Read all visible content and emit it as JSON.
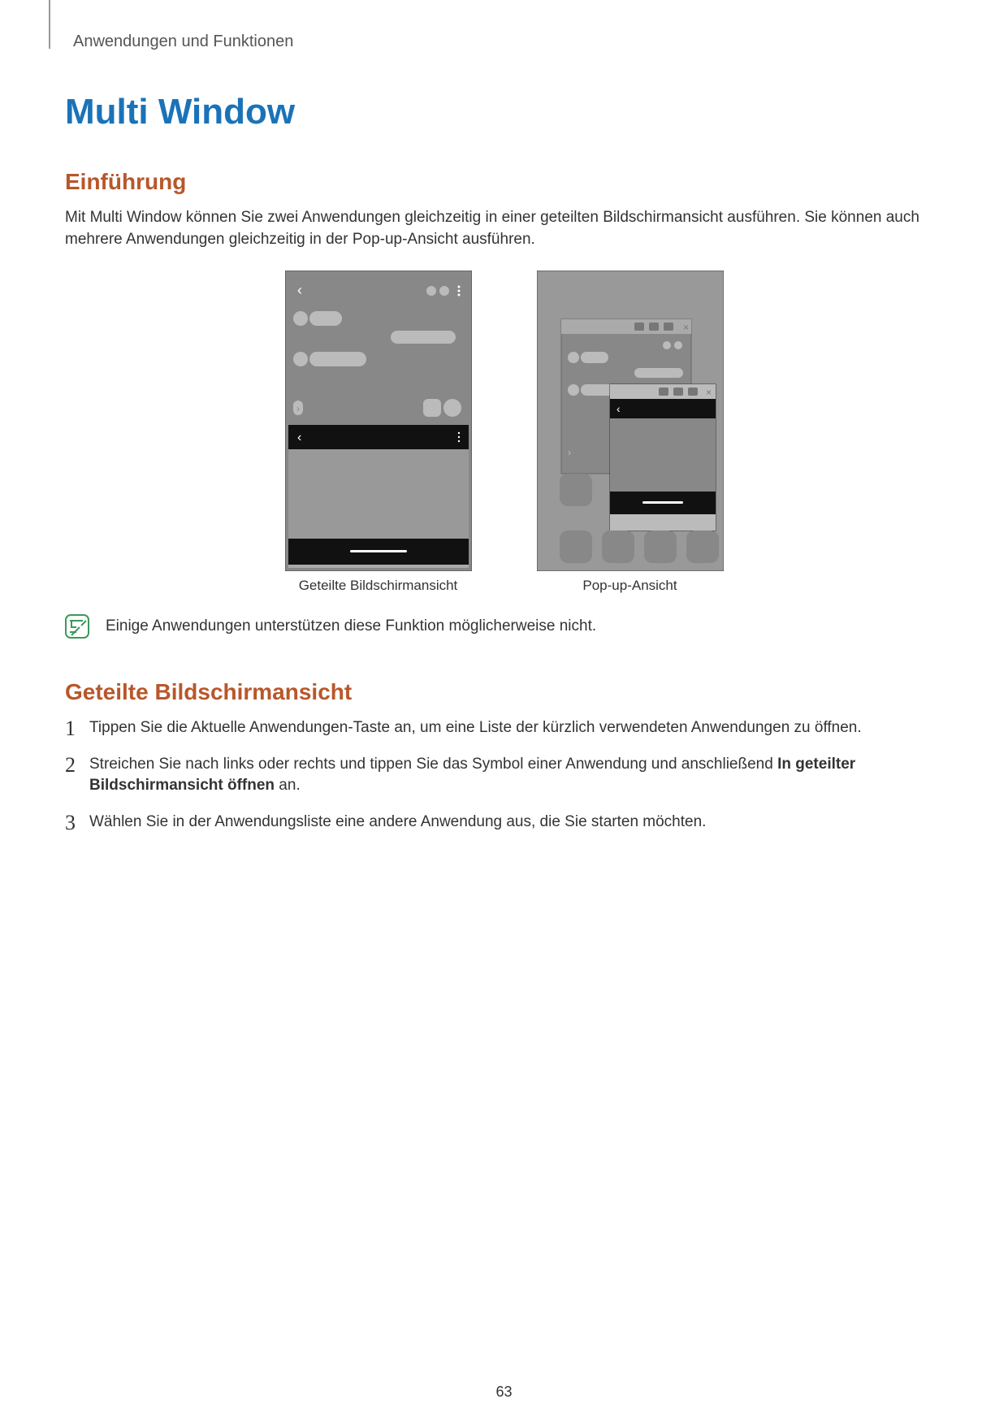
{
  "breadcrumb": "Anwendungen und Funktionen",
  "title": "Multi Window",
  "section_intro_heading": "Einführung",
  "intro_text": "Mit Multi Window können Sie zwei Anwendungen gleichzeitig in einer geteilten Bildschirmansicht ausführen. Sie können auch mehrere Anwendungen gleichzeitig in der Pop-up-Ansicht ausführen.",
  "caption_left": "Geteilte Bildschirmansicht",
  "caption_right": "Pop-up-Ansicht",
  "note_text": "Einige Anwendungen unterstützen diese Funktion möglicherweise nicht.",
  "section_split_heading": "Geteilte Bildschirmansicht",
  "steps": [
    {
      "num": "1",
      "text": "Tippen Sie die Aktuelle Anwendungen-Taste an, um eine Liste der kürzlich verwendeten Anwendungen zu öffnen."
    },
    {
      "num": "2",
      "prefix": "Streichen Sie nach links oder rechts und tippen Sie das Symbol einer Anwendung und anschließend ",
      "bold": "In geteilter Bildschirmansicht öffnen",
      "suffix": " an."
    },
    {
      "num": "3",
      "text": "Wählen Sie in der Anwendungsliste eine andere Anwendung aus, die Sie starten möchten."
    }
  ],
  "page_number": "63"
}
